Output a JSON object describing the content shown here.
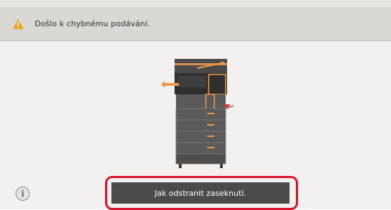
{
  "header": {
    "icon": "warning-icon",
    "icon_color": "#e8a21b",
    "message": "Došlo k chybnému podávání."
  },
  "illustration": {
    "icon": "printer-paper-jam-illustration",
    "highlight_color": "#f19a4c",
    "error_marker_color": "#e5332a"
  },
  "footer": {
    "info_icon": "info-icon",
    "info_glyph": "i",
    "help_button_label": "Jak odstranit zaseknutí.",
    "highlight_color": "#d8152c"
  }
}
